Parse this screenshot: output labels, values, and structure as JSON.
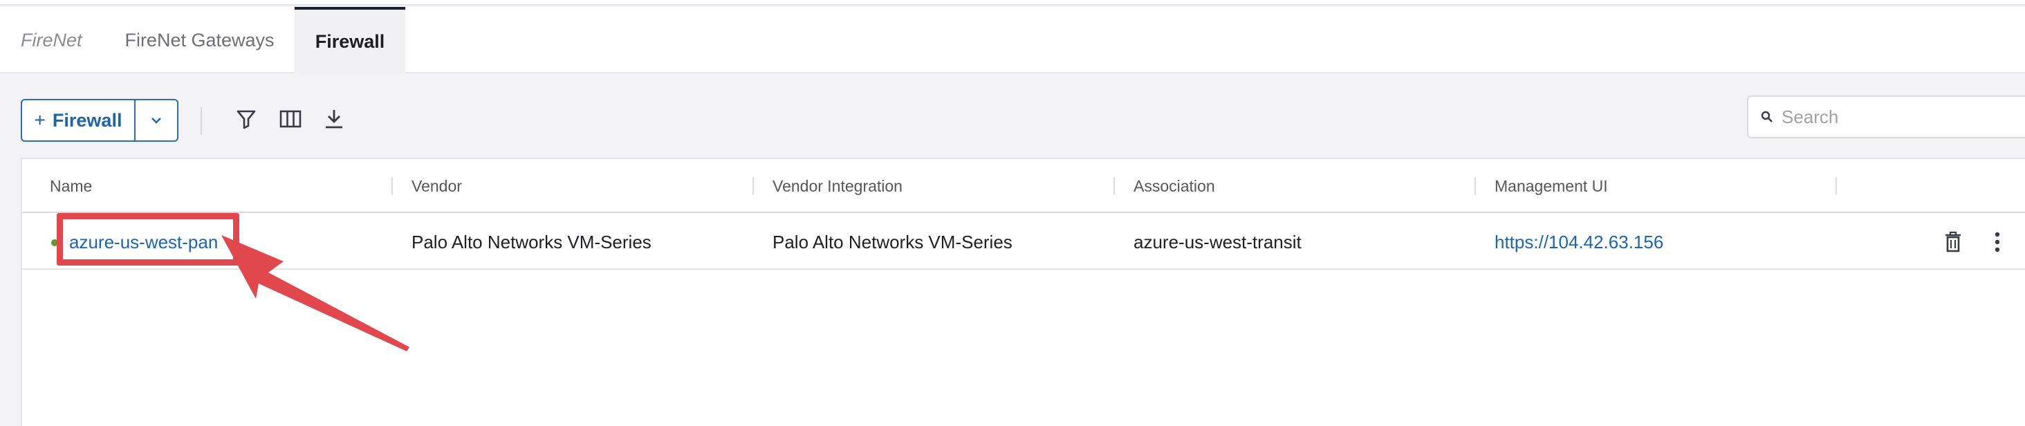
{
  "tabs": {
    "crumb": "FireNet",
    "items": [
      {
        "label": "FireNet Gateways"
      },
      {
        "label": "Firewall"
      }
    ],
    "active": "Firewall"
  },
  "toolbar": {
    "add_plus": "+",
    "add_label": "Firewall",
    "icons": [
      "filter-icon",
      "columns-icon",
      "download-icon"
    ]
  },
  "search": {
    "placeholder": "Search",
    "value": ""
  },
  "table": {
    "columns": [
      "Name",
      "Vendor",
      "Vendor Integration",
      "Association",
      "Management UI"
    ],
    "rows": [
      {
        "status_color": "#5a9b2f",
        "name": "azure-us-west-pan",
        "vendor": "Palo Alto Networks VM-Series",
        "vendor_integration": "Palo Alto Networks VM-Series",
        "association": "azure-us-west-transit",
        "management_ui": "https://104.42.63.156"
      }
    ]
  },
  "colors": {
    "accent": "#1f63a8",
    "link": "#1e64b0",
    "annotation": "#e0484e"
  }
}
